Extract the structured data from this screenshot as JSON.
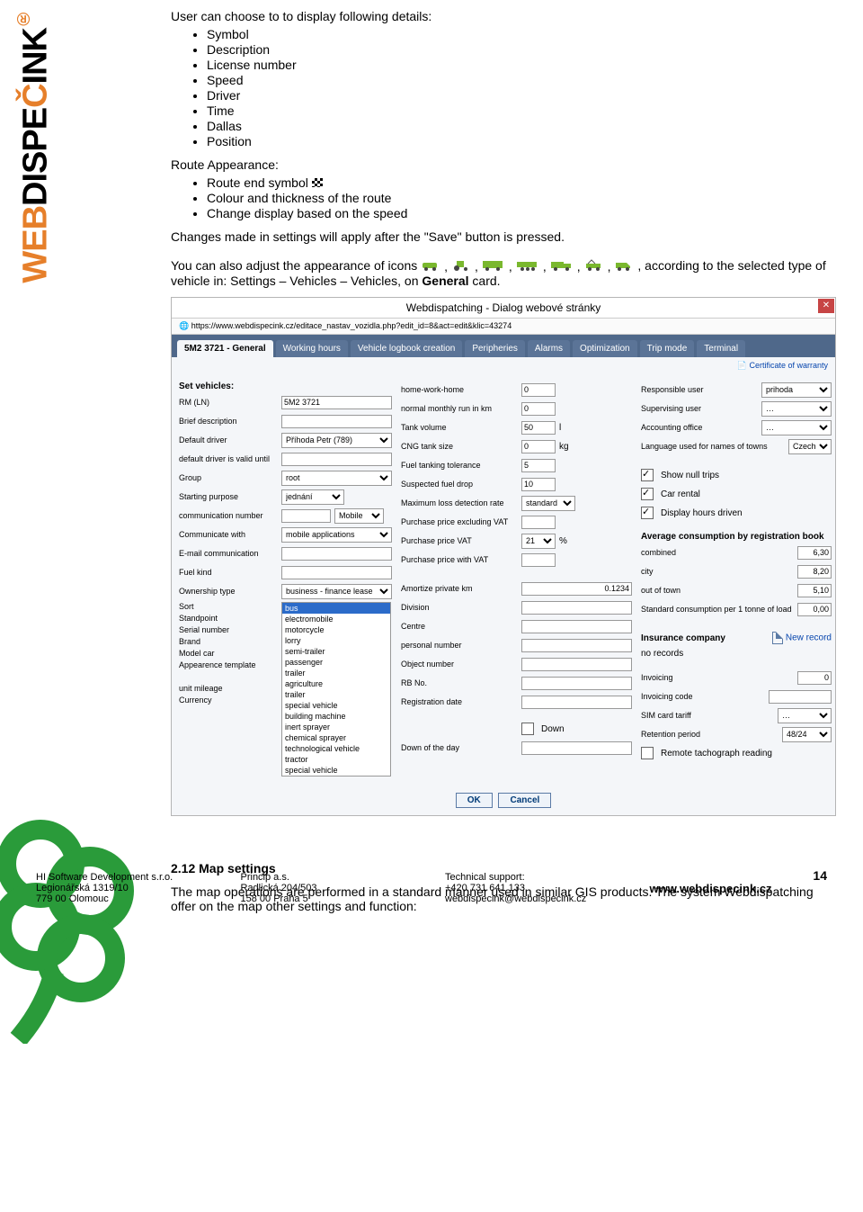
{
  "doc": {
    "p1": "User can choose to to display following details:",
    "list1": [
      "Symbol",
      "Description",
      "License number",
      "Speed",
      "Driver",
      "Time",
      "Dallas",
      "Position"
    ],
    "p2": "Route Appearance:",
    "list2": [
      "Route end symbol",
      "Colour and thickness of the route",
      "Change display based on the speed"
    ],
    "p3": "Changes made in settings will apply after the \"Save\" button is pressed.",
    "p4a": "You can also adjust the appearance of icons ",
    "p4b": ", according to the selected type of vehicle in: Settings – Vehicles – Vehicles, on ",
    "p4bold": "General",
    "p4c": " card.",
    "h3": "2.12  Map settings",
    "p5": "The map operations are performed in a standard manner used in similar GIS products. The system Webdispatching offer on the map other settings and function:"
  },
  "dialog": {
    "title": "Webdispatching - Dialog webové stránky",
    "url": "https://www.webdispecink.cz/editace_nastav_vozidla.php?edit_id=8&act=edit&klic=43274",
    "tabs": [
      "5M2 3721 - General",
      "Working hours",
      "Vehicle logbook creation",
      "Peripheries",
      "Alarms",
      "Optimization",
      "Trip mode",
      "Terminal"
    ],
    "certlink": "Certificate of warranty",
    "c1": {
      "head": "Set vehicles:",
      "rm": {
        "l": "RM (LN)",
        "v": "5M2 3721"
      },
      "bd": {
        "l": "Brief description"
      },
      "dd": {
        "l": "Default driver",
        "v": "Příhoda Petr (789)"
      },
      "dv": {
        "l": "default driver is valid until"
      },
      "gr": {
        "l": "Group",
        "v": "root"
      },
      "sp": {
        "l": "Starting purpose",
        "v": "jednání"
      },
      "cn": {
        "l": "communication number",
        "sel": "Mobile"
      },
      "cw": {
        "l": "Communicate with",
        "v": "mobile applications"
      },
      "em": {
        "l": "E-mail communication"
      },
      "fk": {
        "l": "Fuel kind"
      },
      "ot": {
        "l": "Ownership type",
        "v": "business - finance lease"
      },
      "so": {
        "l": "Sort"
      },
      "st": {
        "l": "Standpoint"
      },
      "sn": {
        "l": "Serial number"
      },
      "br": {
        "l": "Brand"
      },
      "mc": {
        "l": "Model car"
      },
      "at": {
        "l": "Appearence template"
      },
      "um": {
        "l": "unit mileage"
      },
      "cu": {
        "l": "Currency"
      },
      "listbox": [
        "bus",
        "electromobile",
        "motorcycle",
        "lorry",
        "semi-trailer",
        "passenger",
        "trailer",
        "agriculture",
        "trailer",
        "special vehicle",
        "building machine",
        "inert sprayer",
        "chemical sprayer",
        "technological vehicle",
        "tractor",
        "special vehicle"
      ]
    },
    "c2": {
      "hwh": {
        "l": "home-work-home",
        "v": "0"
      },
      "nmr": {
        "l": "normal monthly run in km",
        "v": "0"
      },
      "tv": {
        "l": "Tank volume",
        "v": "50",
        "u": "l"
      },
      "cng": {
        "l": "CNG tank size",
        "v": "0",
        "u": "kg"
      },
      "ft": {
        "l": "Fuel tanking tolerance",
        "v": "5"
      },
      "sf": {
        "l": "Suspected fuel drop",
        "v": "10"
      },
      "ml": {
        "l": "Maximum loss detection rate",
        "v": "standard"
      },
      "pe": {
        "l": "Purchase price excluding VAT"
      },
      "pv": {
        "l": "Purchase price VAT",
        "v": "21",
        "u": "%"
      },
      "pw": {
        "l": "Purchase price with VAT"
      },
      "ap": {
        "l": "Amortize private km",
        "v": "0.1234"
      },
      "di": {
        "l": "Division"
      },
      "ce": {
        "l": "Centre"
      },
      "pn": {
        "l": "personal number"
      },
      "on": {
        "l": "Object number"
      },
      "rb": {
        "l": "RB No."
      },
      "rd": {
        "l": "Registration date"
      },
      "dn": {
        "l": "Down"
      },
      "dd": {
        "l": "Down of the day"
      }
    },
    "c3": {
      "ru": {
        "l": "Responsible user",
        "v": "prihoda"
      },
      "su": {
        "l": "Supervising user",
        "v": "…"
      },
      "ao": {
        "l": "Accounting office",
        "v": "…"
      },
      "la": {
        "l": "Language used for names of towns",
        "v": "Czech"
      },
      "cb1": "Show null trips",
      "cb2": "Car rental",
      "cb3": "Display hours driven",
      "avg": {
        "h": "Average consumption by registration book",
        "comb": {
          "l": "combined",
          "v": "6,30"
        },
        "city": {
          "l": "city",
          "v": "8,20"
        },
        "out": {
          "l": "out of town",
          "v": "5,10"
        },
        "std": {
          "l": "Standard consumption per 1 tonne of load",
          "v": "0,00"
        }
      },
      "ins": {
        "h": "Insurance company",
        "new": "New record",
        "nr": "no records"
      },
      "inv": {
        "l": "Invoicing",
        "v": "0"
      },
      "ic": {
        "l": "Invoicing code"
      },
      "sc": {
        "l": "SIM card tariff",
        "v": "…"
      },
      "rp": {
        "l": "Retention period",
        "v": "48/24"
      },
      "rt": "Remote tachograph reading"
    },
    "btn": {
      "ok": "OK",
      "cancel": "Cancel"
    }
  },
  "footer": {
    "c1": [
      "HI Software Development s.r.o.",
      "Legionářská 1319/10",
      "779 00 Olomouc"
    ],
    "c2": [
      "Princip a.s.",
      "Radlická 204/503",
      "158 00 Praha 5"
    ],
    "c3": [
      "Technical support:",
      "+420 731 641 133",
      "webdispecink@webdispecink.cz"
    ],
    "www": "www.webdispecink.cz",
    "page": "14"
  }
}
